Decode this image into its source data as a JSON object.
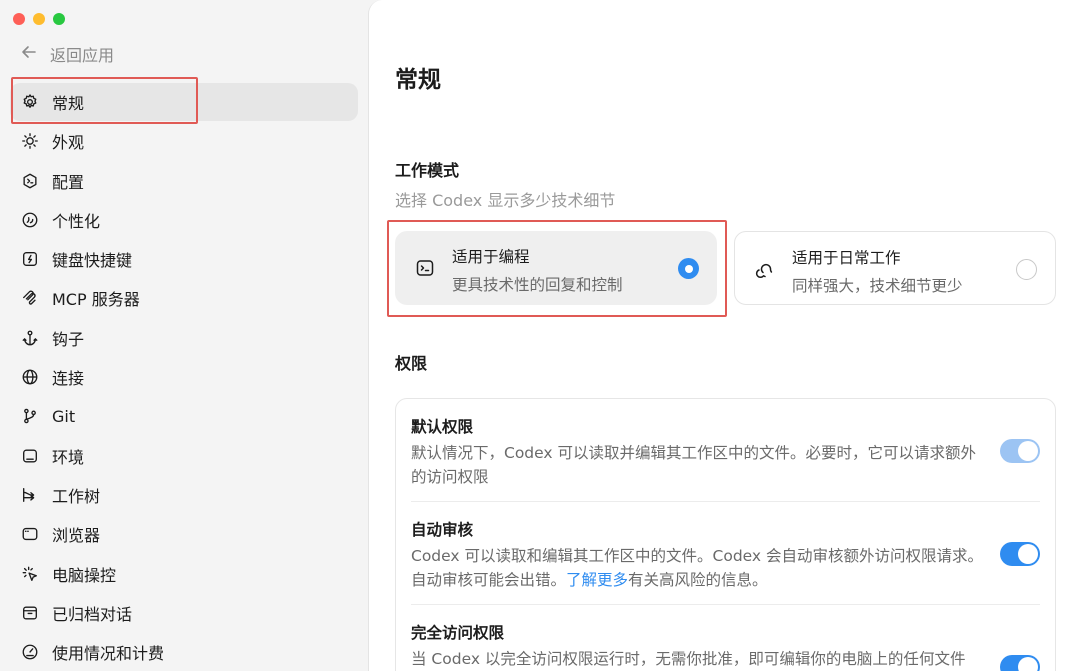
{
  "sidebar": {
    "back_label": "返回应用",
    "items": [
      {
        "label": "常规",
        "icon": "gear-icon",
        "active": true
      },
      {
        "label": "外观",
        "icon": "sun-icon"
      },
      {
        "label": "配置",
        "icon": "config-icon"
      },
      {
        "label": "个性化",
        "icon": "personalize-icon"
      },
      {
        "label": "键盘快捷键",
        "icon": "keyboard-icon"
      },
      {
        "label": "MCP 服务器",
        "icon": "mcp-icon"
      },
      {
        "label": "钩子",
        "icon": "anchor-icon"
      },
      {
        "label": "连接",
        "icon": "globe-icon"
      },
      {
        "label": "Git",
        "icon": "git-branch-icon"
      },
      {
        "label": "环境",
        "icon": "environment-icon"
      },
      {
        "label": "工作树",
        "icon": "worktree-icon"
      },
      {
        "label": "浏览器",
        "icon": "browser-icon"
      },
      {
        "label": "电脑操控",
        "icon": "cursor-click-icon"
      },
      {
        "label": "已归档对话",
        "icon": "archive-icon"
      },
      {
        "label": "使用情况和计费",
        "icon": "gauge-icon"
      }
    ]
  },
  "main": {
    "title": "常规",
    "work_mode": {
      "title": "工作模式",
      "subtitle": "选择 Codex 显示多少技术细节",
      "options": [
        {
          "title": "适用于编程",
          "desc": "更具技术性的回复和控制",
          "selected": true,
          "icon": "terminal-icon"
        },
        {
          "title": "适用于日常工作",
          "desc": "同样强大，技术细节更少",
          "selected": false,
          "icon": "chat-bubbles-icon"
        }
      ]
    },
    "permissions": {
      "title": "权限",
      "rows": [
        {
          "title": "默认权限",
          "desc": "默认情况下，Codex 可以读取并编辑其工作区中的文件。必要时，它可以请求额外的访问权限",
          "enabled": true,
          "disabled_state": true
        },
        {
          "title": "自动审核",
          "desc_pre": "Codex 可以读取和编辑其工作区中的文件。Codex 会自动审核额外访问权限请求。自动审核可能会出错。",
          "link": "了解更多",
          "desc_post": "有关高风险的信息。",
          "enabled": true
        },
        {
          "title": "完全访问权限",
          "desc": "当 Codex 以完全访问权限运行时，无需你批准，即可编辑你的电脑上的任何文件",
          "enabled": true
        }
      ]
    }
  },
  "colors": {
    "accent": "#2f8cf0",
    "highlight": "#e05a55"
  }
}
